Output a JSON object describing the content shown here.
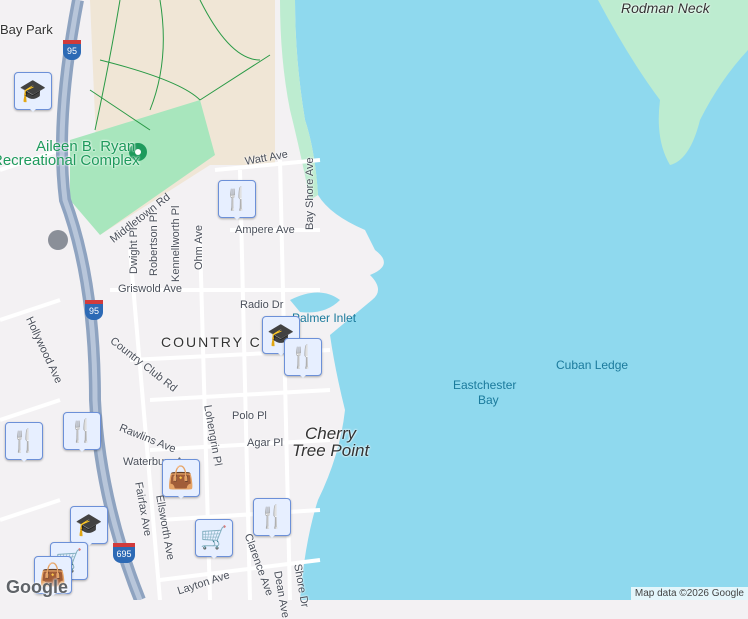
{
  "colors": {
    "water": "#8fd9ee",
    "land": "#f3f1f3",
    "park": "#a8e6bd",
    "beach": "#f0e6d6",
    "highway": "#8ea3c0",
    "marker": "#0b3f63"
  },
  "places": {
    "rodman_neck": "Rodman Neck",
    "park_name_line1": "Aileen B. Ryan",
    "park_name_line2": "Recreational Complex",
    "neighborhood": "COUNTRY CLUB",
    "point_line1": "Cherry",
    "point_line2": "Tree Point",
    "bay_line1": "Eastchester",
    "bay_line2": "Bay",
    "cuban_ledge": "Cuban Ledge",
    "palmer_inlet": "Palmer Inlet",
    "bay_park": "Bay Park"
  },
  "streets": [
    "Watt Ave",
    "Bay Shore Ave",
    "Ampere Ave",
    "Middletown Rd",
    "Dwight Pl",
    "Robertson Pl",
    "Kennellworth Pl",
    "Ohm Ave",
    "Griswold Ave",
    "Radio Dr",
    "Country Club Rd",
    "Polo Pl",
    "Rawlins Ave",
    "Agar Pl",
    "Lohengrin Pl",
    "Waterbury Ave",
    "Fairfax Ave",
    "Ellsworth Ave",
    "Clarence Ave",
    "Dean Ave",
    "Shore Dr",
    "Layton Ave",
    "Hollywood Ave"
  ],
  "highways": [
    "95",
    "95",
    "695"
  ],
  "attribution": "Map data ©2026 Google",
  "logo": "Google",
  "markers": [
    {
      "type": "school-icon",
      "glyph": "🎓"
    },
    {
      "type": "restaurant-icon",
      "glyph": "🍴"
    },
    {
      "type": "school-icon",
      "glyph": "🎓"
    },
    {
      "type": "restaurant-icon",
      "glyph": "🍴"
    },
    {
      "type": "restaurant-icon",
      "glyph": "🍴"
    },
    {
      "type": "restaurant-icon",
      "glyph": "🍴"
    },
    {
      "type": "shopping-bag-icon",
      "glyph": "👜"
    },
    {
      "type": "restaurant-icon",
      "glyph": "🍴"
    },
    {
      "type": "shopping-cart-icon",
      "glyph": "🛒"
    },
    {
      "type": "school-icon",
      "glyph": "🎓"
    },
    {
      "type": "shopping-cart-icon",
      "glyph": "🛒"
    },
    {
      "type": "shopping-bag-icon",
      "glyph": "👜"
    }
  ]
}
